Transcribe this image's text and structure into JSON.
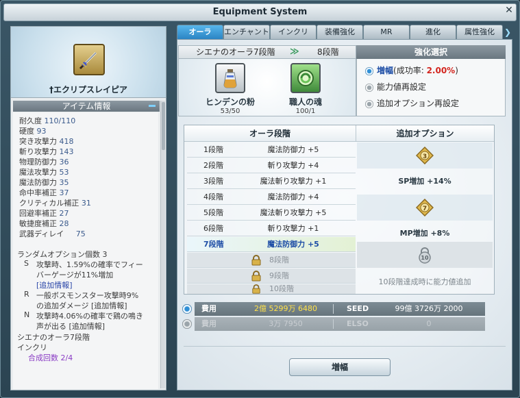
{
  "window": {
    "title": "Equipment System",
    "close_label": "✕"
  },
  "item": {
    "name": "†エクリプスレイピア",
    "icon": "rapier-icon",
    "info_header": "アイテム情報",
    "stats": [
      {
        "label": "耐久度",
        "value": "110/110"
      },
      {
        "label": "硬度",
        "value": "93"
      },
      {
        "label": "突き攻撃力",
        "value": "418"
      },
      {
        "label": "斬り攻撃力",
        "value": "143"
      },
      {
        "label": "物理防御力",
        "value": "36"
      },
      {
        "label": "魔法攻撃力",
        "value": "53"
      },
      {
        "label": "魔法防御力",
        "value": "35"
      },
      {
        "label": "命中率補正",
        "value": "37"
      },
      {
        "label": "クリティカル補正",
        "value": "31"
      },
      {
        "label": "回避率補正",
        "value": "27"
      },
      {
        "label": "敏捷度補正",
        "value": "28"
      },
      {
        "label": "武器ディレイ",
        "value": "75"
      }
    ],
    "random_option_count": "ランダムオプション個数 3",
    "random_options": [
      {
        "grade": "S",
        "line1": "攻撃時、1.59%の確率でフィー",
        "line2": "バーゲージが11%増加",
        "line3": "[追加情報]"
      },
      {
        "grade": "R",
        "line1": "一般ボスモンスター攻撃時9%",
        "line2": "の追加ダメージ [追加情報]",
        "line3": ""
      },
      {
        "grade": "N",
        "line1": "攻撃時4.06%の確率で鶏の鳴き",
        "line2": "声が出る [追加情報]",
        "line3": ""
      }
    ],
    "aura_line": "シエナのオーラ7段階",
    "inkuri_line": "インクリ",
    "synthesis_line": "合成回数 2/4"
  },
  "tabs": [
    "オーラ",
    "エンチャント",
    "インクリ",
    "装備強化",
    "MR",
    "進化",
    "属性強化"
  ],
  "active_tab": 0,
  "stage": {
    "from": "シエナのオーラ7段階",
    "arrow": "≫",
    "to": "8段階"
  },
  "materials": [
    {
      "name": "ヒンデンの粉",
      "count": "53/50",
      "icon": "powder-vial-icon"
    },
    {
      "name": "職人の魂",
      "count": "100/1",
      "icon": "craftsman-soul-icon"
    }
  ],
  "enhance": {
    "header": "強化選択",
    "options": [
      {
        "label": "増幅",
        "rate_prefix": "(成功率: ",
        "rate": "2.00%",
        "rate_suffix": ")",
        "selected": true
      },
      {
        "label": "能力値再設定",
        "selected": false
      },
      {
        "label": "追加オプション再設定",
        "selected": false
      }
    ]
  },
  "aura_table": {
    "col_stage": "オーラ段階",
    "col_option": "追加オプション",
    "rows": [
      {
        "level": "1段階",
        "effect": "魔法防御力 +5",
        "state": "normal"
      },
      {
        "level": "2段階",
        "effect": "斬り攻撃力 +4",
        "state": "normal"
      },
      {
        "level": "3段階",
        "effect": "魔法斬り攻撃力 +1",
        "state": "normal"
      },
      {
        "level": "4段階",
        "effect": "魔法防御力 +4",
        "state": "normal"
      },
      {
        "level": "5段階",
        "effect": "魔法斬り攻撃力 +5",
        "state": "normal"
      },
      {
        "level": "6段階",
        "effect": "斬り攻撃力 +1",
        "state": "normal"
      },
      {
        "level": "7段階",
        "effect": "魔法防御力 +5",
        "state": "current"
      },
      {
        "level": "",
        "effect": "8段階",
        "state": "locked"
      },
      {
        "level": "",
        "effect": "9段階",
        "state": "locked"
      },
      {
        "level": "",
        "effect": "10段階",
        "state": "locked"
      }
    ],
    "additional": [
      {
        "badge": "3",
        "text": ""
      },
      {
        "badge": "",
        "text": "SP増加 +14%"
      },
      {
        "badge": "7",
        "text": ""
      },
      {
        "badge": "",
        "text": "MP増加 +8%"
      },
      {
        "badge": "10",
        "text": ""
      },
      {
        "badge": "",
        "text": "10段階達成時に能力値追加"
      }
    ]
  },
  "costs": [
    {
      "label": "費用",
      "amount": "2億 5299万 6480",
      "label2": "SEED",
      "amount2": "99億 3726万 2000",
      "selected": true
    },
    {
      "label": "費用",
      "amount": "3万 7950",
      "label2": "ELSO",
      "amount2": "0",
      "selected": false
    }
  ],
  "amplify_button": "増幅",
  "colors": {
    "accent": "#2b85c4",
    "rate": "#d3261f",
    "current_stage": "#1e4ea6",
    "cost_gold": "#ffe14a"
  }
}
